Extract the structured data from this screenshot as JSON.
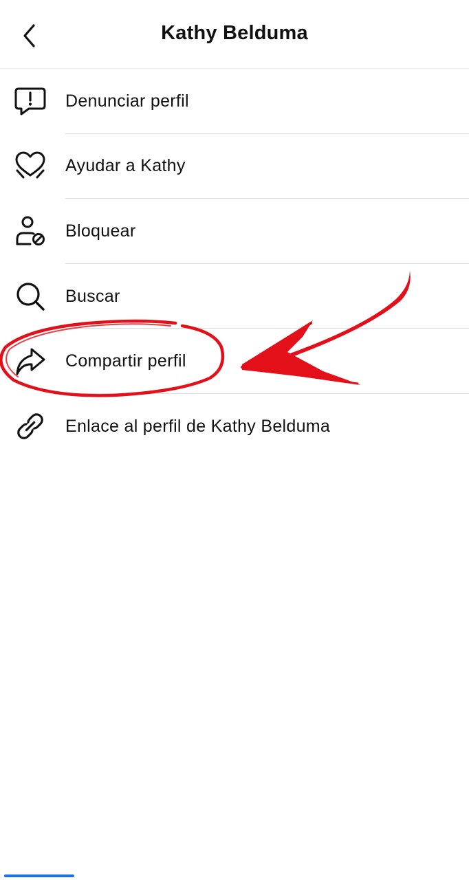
{
  "header": {
    "title": "Kathy Belduma",
    "back_icon": "chevron-left-icon"
  },
  "menu": {
    "items": [
      {
        "label": "Denunciar perfil",
        "icon": "report-bubble-icon"
      },
      {
        "label": "Ayudar a Kathy",
        "icon": "heart-hands-icon"
      },
      {
        "label": "Bloquear",
        "icon": "block-user-icon"
      },
      {
        "label": "Buscar",
        "icon": "search-icon"
      },
      {
        "label": "Compartir perfil",
        "icon": "share-arrow-icon"
      },
      {
        "label": "Enlace al perfil de Kathy Belduma",
        "icon": "link-icon"
      }
    ]
  },
  "annotation": {
    "highlighted_item": "Compartir perfil",
    "color": "#e3101a"
  },
  "colors": {
    "accent": "#1f6fe0",
    "divider": "#dcdcdc",
    "text": "#111111"
  }
}
